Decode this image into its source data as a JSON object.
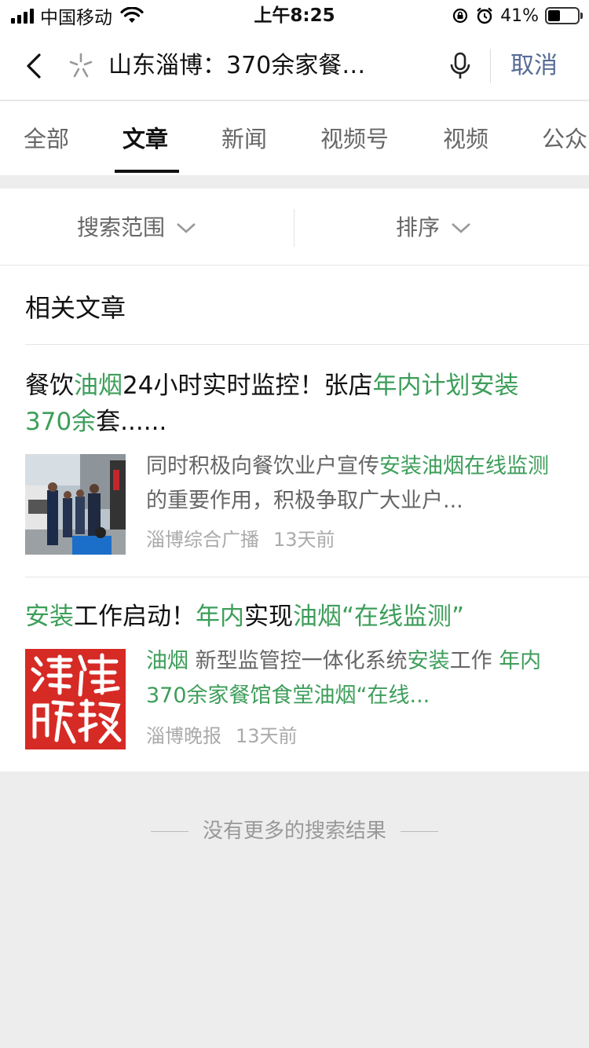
{
  "status_bar": {
    "carrier": "中国移动",
    "time": "上午8:25",
    "battery_percent": "41%",
    "battery_level": 0.41
  },
  "search": {
    "query": "山东淄博：370余家餐…",
    "cancel_label": "取消"
  },
  "tabs": [
    {
      "label": "全部",
      "active": false
    },
    {
      "label": "文章",
      "active": true
    },
    {
      "label": "新闻",
      "active": false
    },
    {
      "label": "视频号",
      "active": false
    },
    {
      "label": "视频",
      "active": false
    },
    {
      "label": "公众",
      "active": false
    }
  ],
  "filters": {
    "scope_label": "搜索范围",
    "sort_label": "排序"
  },
  "section_title": "相关文章",
  "articles": [
    {
      "title_parts": [
        {
          "text": "餐饮",
          "hl": false
        },
        {
          "text": "油烟",
          "hl": true
        },
        {
          "text": "24小时实时监控！张店",
          "hl": false
        },
        {
          "text": "年内计划安装370余",
          "hl": true
        },
        {
          "text": "套......",
          "hl": false
        }
      ],
      "desc_parts": [
        {
          "text": "同时积极向餐饮业户宣传",
          "hl": false
        },
        {
          "text": "安装油烟在线监测",
          "hl": true
        },
        {
          "text": "的重要作用，积极争取广大业户...",
          "hl": false
        }
      ],
      "source": "淄博综合广播",
      "time": "13天前",
      "thumb_icon": "photo-thumbnail"
    },
    {
      "title_parts": [
        {
          "text": "安装",
          "hl": true
        },
        {
          "text": "工作启动！",
          "hl": false
        },
        {
          "text": "年内",
          "hl": true
        },
        {
          "text": "实现",
          "hl": false
        },
        {
          "text": "油烟“在线监测”",
          "hl": true
        }
      ],
      "desc_parts": [
        {
          "text": "油烟",
          "hl": true
        },
        {
          "text": " 新型监管控一体化系统",
          "hl": false
        },
        {
          "text": "安装",
          "hl": true
        },
        {
          "text": "工作 ",
          "hl": false
        },
        {
          "text": "年内370余家餐馆食堂油烟“在线...",
          "hl": true
        }
      ],
      "source": "淄博晚报",
      "time": "13天前",
      "thumb_logo_text": "淄博晚报"
    }
  ],
  "no_more_text": "没有更多的搜索结果",
  "colors": {
    "highlight": "#3d9e5a",
    "link": "#576b95",
    "logo_red": "#d62a25"
  }
}
